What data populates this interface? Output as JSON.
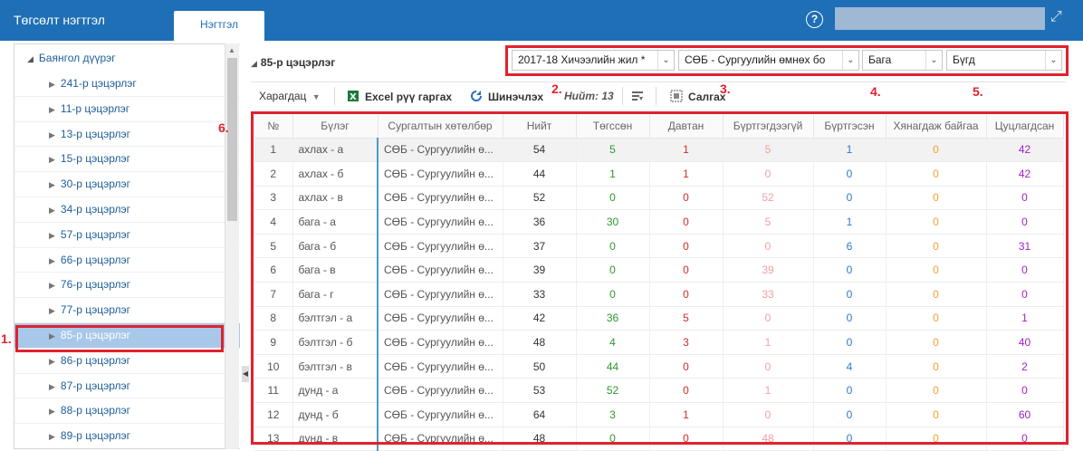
{
  "app": {
    "title": "Төгсөлт нэгтгэл",
    "tab": "Нэгтгэл"
  },
  "icons": {
    "help": "question-circle-icon",
    "expand": "expand-arrows-icon",
    "excel": "excel-icon",
    "refresh": "refresh-icon",
    "settings": "filter-settings-icon",
    "print": "print-icon"
  },
  "sidebar": {
    "root": "Баянгол дүүрэг",
    "items": [
      {
        "label": "241-р цэцэрлэг"
      },
      {
        "label": "11-р цэцэрлэг"
      },
      {
        "label": "13-р цэцэрлэг"
      },
      {
        "label": "15-р цэцэрлэг"
      },
      {
        "label": "30-р цэцэрлэг"
      },
      {
        "label": "34-р цэцэрлэг"
      },
      {
        "label": "57-р цэцэрлэг"
      },
      {
        "label": "66-р цэцэрлэг"
      },
      {
        "label": "76-р цэцэрлэг"
      },
      {
        "label": "77-р цэцэрлэг"
      },
      {
        "label": "85-р цэцэрлэг"
      },
      {
        "label": "86-р цэцэрлэг"
      },
      {
        "label": "87-р цэцэрлэг"
      },
      {
        "label": "88-р цэцэрлэг"
      },
      {
        "label": "89-р цэцэрлэг"
      }
    ],
    "selected": "85-р цэцэрлэг"
  },
  "annotations": [
    "1.",
    "2.",
    "3.",
    "4.",
    "5.",
    "6."
  ],
  "main": {
    "title": "85-р цэцэрлэг"
  },
  "filters": {
    "year": "2017-18 Хичээлийн жил *",
    "program": "СӨБ - Сургуулийн өмнөх бо",
    "level": "Бага",
    "group": "Бүгд"
  },
  "toolbar": {
    "view": "Харагдац",
    "excel": "Excel рүү гаргах",
    "refresh": "Шинэчлэх",
    "total": "Нийт: 13",
    "print": "Салгах"
  },
  "table": {
    "headers": [
      "№",
      "Бүлэг",
      "Сургалтын хөтөлбөр",
      "Нийт",
      "Төгссөн",
      "Давтан",
      "Бүртгэгдээгүй",
      "Бүртгэсэн",
      "Хянагдаж байгаа",
      "Цуцлагдсан"
    ],
    "rows": [
      [
        "1",
        "ахлах - а",
        "СӨБ - Сургуулийн ө...",
        "54",
        "5",
        "1",
        "5",
        "1",
        "0",
        "42"
      ],
      [
        "2",
        "ахлах - б",
        "СӨБ - Сургуулийн ө...",
        "44",
        "1",
        "1",
        "0",
        "0",
        "0",
        "42"
      ],
      [
        "3",
        "ахлах - в",
        "СӨБ - Сургуулийн ө...",
        "52",
        "0",
        "0",
        "52",
        "0",
        "0",
        "0"
      ],
      [
        "4",
        "бага - а",
        "СӨБ - Сургуулийн ө...",
        "36",
        "30",
        "0",
        "5",
        "1",
        "0",
        "0"
      ],
      [
        "5",
        "бага - б",
        "СӨБ - Сургуулийн ө...",
        "37",
        "0",
        "0",
        "0",
        "6",
        "0",
        "31"
      ],
      [
        "6",
        "бага - в",
        "СӨБ - Сургуулийн ө...",
        "39",
        "0",
        "0",
        "39",
        "0",
        "0",
        "0"
      ],
      [
        "7",
        "бага - г",
        "СӨБ - Сургуулийн ө...",
        "33",
        "0",
        "0",
        "33",
        "0",
        "0",
        "0"
      ],
      [
        "8",
        "бэлтгэл - а",
        "СӨБ - Сургуулийн ө...",
        "42",
        "36",
        "5",
        "0",
        "0",
        "0",
        "1"
      ],
      [
        "9",
        "бэлтгэл - б",
        "СӨБ - Сургуулийн ө...",
        "48",
        "4",
        "3",
        "1",
        "0",
        "0",
        "40"
      ],
      [
        "10",
        "бэлтгэл - в",
        "СӨБ - Сургуулийн ө...",
        "50",
        "44",
        "0",
        "0",
        "4",
        "0",
        "2"
      ],
      [
        "11",
        "дунд - а",
        "СӨБ - Сургуулийн ө...",
        "53",
        "52",
        "0",
        "1",
        "0",
        "0",
        "0"
      ],
      [
        "12",
        "дунд - б",
        "СӨБ - Сургуулийн ө...",
        "64",
        "3",
        "1",
        "0",
        "0",
        "0",
        "60"
      ],
      [
        "13",
        "дунд - в",
        "СӨБ - Сургуулийн ө...",
        "48",
        "0",
        "0",
        "48",
        "0",
        "0",
        "0"
      ]
    ]
  },
  "colors": {
    "brand": "#1f6fb6",
    "highlight": "#e0222e",
    "selected": "#a8c8ea"
  }
}
